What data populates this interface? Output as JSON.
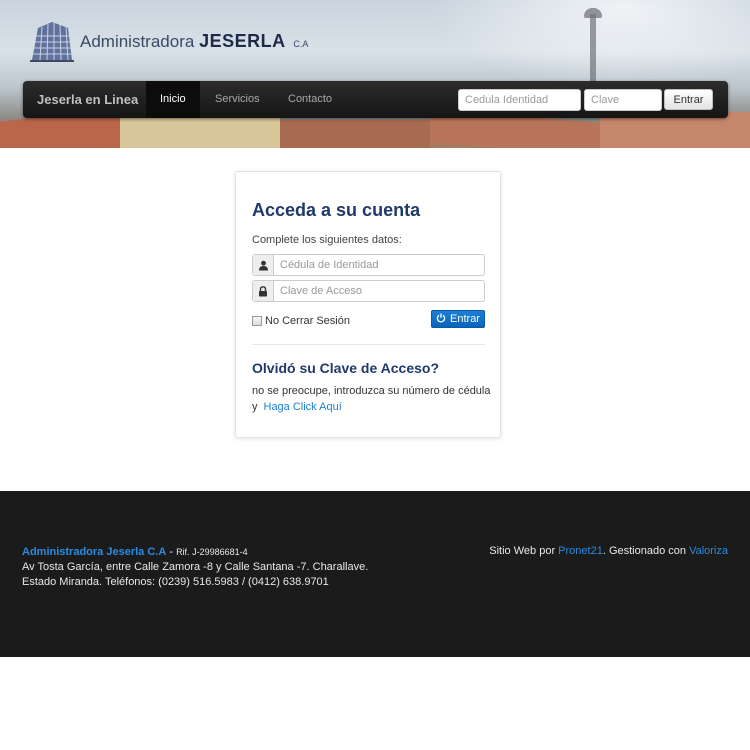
{
  "header": {
    "logo": {
      "name_prefix": "Administradora",
      "name_strong": "JESERLA",
      "name_suffix": "C.A"
    }
  },
  "navbar": {
    "brand": "Jeserla en Linea",
    "items": [
      {
        "label": "Inicio",
        "active": true
      },
      {
        "label": "Servicios",
        "active": false
      },
      {
        "label": "Contacto",
        "active": false
      }
    ],
    "cedula_placeholder": "Cedula Identidad",
    "clave_placeholder": "Clave",
    "submit_label": "Entrar"
  },
  "login": {
    "title": "Acceda a su cuenta",
    "subtitle": "Complete los siguientes datos:",
    "cedula_placeholder": "Cédula de Identidad",
    "clave_placeholder": "Clave de Acceso",
    "remember_label": "No Cerrar Sesión",
    "submit_label": "Entrar",
    "forgot_title": "Olvidó su Clave de Acceso?",
    "forgot_text": "no se preocupe, introduzca su número de cédula y",
    "forgot_link": "Haga Click Aquí"
  },
  "footer": {
    "company": "Administradora Jeserla C.A",
    "separator": " - ",
    "rif": "Rif. J-29986681-4",
    "address_line1": "Av Tosta García, entre Calle Zamora -8 y Calle Santana -7. Charallave.",
    "address_line2": "Estado Miranda. Teléfonos: (0239) 516.5983 / (0412) 638.9701",
    "credit_prefix": "Sitio Web por ",
    "credit_link1": "Pronet21",
    "credit_middle": ". Gestionado con ",
    "credit_link2": "Valoriza"
  },
  "colors": {
    "accent": "#1a7fd8",
    "title": "#1f3a6a",
    "navbar": "#1b1b1b",
    "footer": "#1b1b1b"
  }
}
